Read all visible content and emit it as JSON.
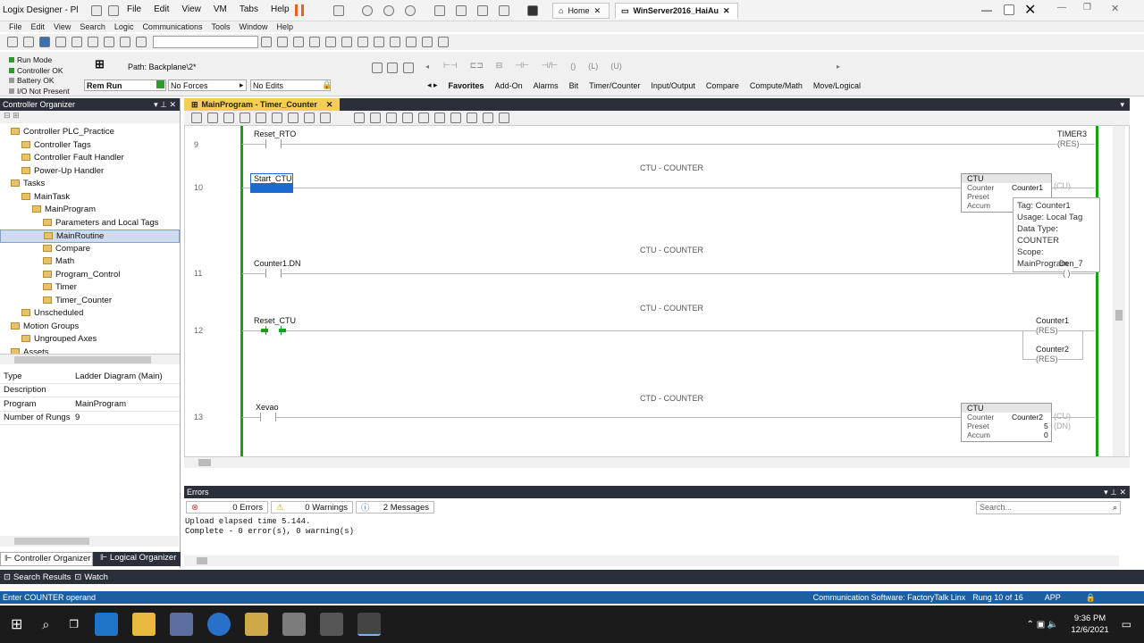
{
  "vmbar": {
    "app_title": "Logix Designer - Pl",
    "menu": [
      "File",
      "Edit",
      "View",
      "VM",
      "Tabs",
      "Help"
    ],
    "tab_home": "Home",
    "tab_vm": "WinServer2016_HaiAu"
  },
  "appmenu": [
    "File",
    "Edit",
    "View",
    "Search",
    "Logic",
    "Communications",
    "Tools",
    "Window",
    "Help"
  ],
  "status": {
    "run_mode": "Run Mode",
    "controller_ok": "Controller OK",
    "battery_ok": "Battery OK",
    "io": "I/O Not Present",
    "mode": "Rem Run",
    "forces": "No Forces",
    "edits": "No Edits",
    "path": "Path: Backplane\\2*"
  },
  "instr_tabs": [
    "Favorites",
    "Add-On",
    "Alarms",
    "Bit",
    "Timer/Counter",
    "Input/Output",
    "Compare",
    "Compute/Math",
    "Move/Logical"
  ],
  "organizer": {
    "title": "Controller Organizer",
    "tree": [
      {
        "label": "Controller PLC_Practice",
        "indent": 1
      },
      {
        "label": "Controller Tags",
        "indent": 2
      },
      {
        "label": "Controller Fault Handler",
        "indent": 2
      },
      {
        "label": "Power-Up Handler",
        "indent": 2
      },
      {
        "label": "Tasks",
        "indent": 1
      },
      {
        "label": "MainTask",
        "indent": 2
      },
      {
        "label": "MainProgram",
        "indent": 3
      },
      {
        "label": "Parameters and Local Tags",
        "indent": 4
      },
      {
        "label": "MainRoutine",
        "indent": 4,
        "selected": true
      },
      {
        "label": "Compare",
        "indent": 4
      },
      {
        "label": "Math",
        "indent": 4
      },
      {
        "label": "Program_Control",
        "indent": 4
      },
      {
        "label": "Timer",
        "indent": 4
      },
      {
        "label": "Timer_Counter",
        "indent": 4
      },
      {
        "label": "Unscheduled",
        "indent": 2
      },
      {
        "label": "Motion Groups",
        "indent": 1
      },
      {
        "label": "Ungrouped Axes",
        "indent": 2
      },
      {
        "label": "Assets",
        "indent": 1
      },
      {
        "label": "Logical Model",
        "indent": 1
      }
    ]
  },
  "props": [
    {
      "k": "Type",
      "v": "Ladder Diagram (Main)"
    },
    {
      "k": "Description",
      "v": ""
    },
    {
      "k": "Program",
      "v": "MainProgram"
    },
    {
      "k": "Number of Rungs",
      "v": "9"
    }
  ],
  "organizer_tabs": {
    "controller": "Controller Organizer",
    "logical": "Logical Organizer"
  },
  "editor": {
    "tab": "MainProgram - Timer_Counter",
    "r9": {
      "num": "9",
      "tag": "Reset_RTO",
      "coil": "TIMER3",
      "coil_type": "(RES)"
    },
    "r10": {
      "num": "10",
      "cmt": "CTU - COUNTER",
      "tag": "Start_CTU",
      "box": "CTU",
      "counter": "Counter",
      "counter_v": "Counter1",
      "preset": "Preset",
      "accum": "Accum",
      "cu": "(CU)",
      "dn": "(DN)"
    },
    "tooltip": [
      "Tag: Counter1",
      "Usage: Local Tag",
      "Data Type: COUNTER",
      "Scope: MainProgram"
    ],
    "r11": {
      "num": "11",
      "cmt": "CTU - COUNTER",
      "tag": "Counter1.DN",
      "coil": "Den_7"
    },
    "r12": {
      "num": "12",
      "cmt": "CTU - COUNTER",
      "tag": "Reset_CTU",
      "coil1": "Counter1",
      "coil2": "Counter2",
      "res": "(RES)"
    },
    "r13": {
      "num": "13",
      "cmt": "CTD - COUNTER",
      "tag": "Xevao",
      "box": "CTU",
      "counter": "Counter",
      "counter_v": "Counter2",
      "preset": "Preset",
      "preset_v": "5",
      "accum": "Accum",
      "accum_v": "0",
      "cu": "(CU)",
      "dn": "(DN)"
    }
  },
  "errors": {
    "title": "Errors",
    "errors": "0 Errors",
    "warnings": "0 Warnings",
    "messages": "2 Messages",
    "search": "Search...",
    "line1": "Upload elapsed time 5.144.",
    "line2": "Complete - 0 error(s), 0 warning(s)"
  },
  "bottom": {
    "search_results": "Search Results",
    "watch": "Watch"
  },
  "statusbar": {
    "left": "Enter COUNTER operand",
    "comm": "Communication Software: FactoryTalk Linx",
    "rung": "Rung 10 of 16",
    "app": "APP"
  },
  "taskbar": {
    "time": "9:36 PM",
    "date": "12/6/2021"
  }
}
